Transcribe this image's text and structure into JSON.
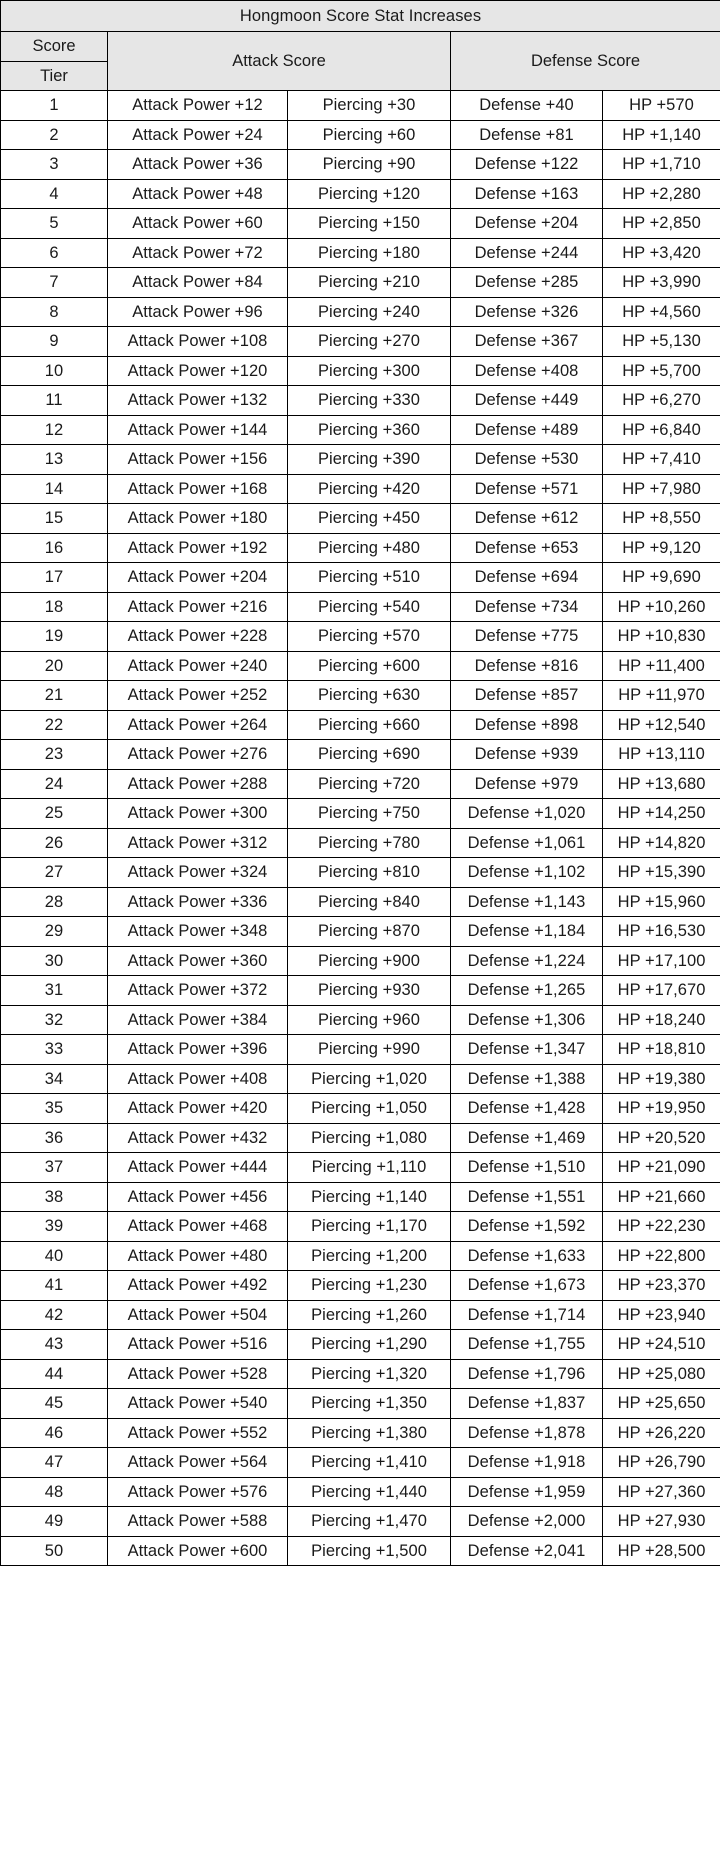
{
  "table": {
    "title": "Hongmoon Score Stat Increases",
    "header": {
      "score_label": "Score",
      "tier_label": "Tier",
      "attack_group": "Attack Score",
      "defense_group": "Defense Score"
    },
    "columns": [
      "Tier",
      "Attack Power",
      "Piercing",
      "Defense",
      "HP"
    ],
    "colors": {
      "header_bg": "#e6e6e6",
      "body_bg": "#ffffff",
      "border": "#000000",
      "text": "#1a1a1a"
    },
    "rows": [
      {
        "tier": "1",
        "attack": "Attack Power +12",
        "piercing": "Piercing +30",
        "defense": "Defense +40",
        "hp": "HP +570"
      },
      {
        "tier": "2",
        "attack": "Attack Power +24",
        "piercing": "Piercing +60",
        "defense": "Defense +81",
        "hp": "HP +1,140"
      },
      {
        "tier": "3",
        "attack": "Attack Power +36",
        "piercing": "Piercing +90",
        "defense": "Defense +122",
        "hp": "HP +1,710"
      },
      {
        "tier": "4",
        "attack": "Attack Power +48",
        "piercing": "Piercing +120",
        "defense": "Defense +163",
        "hp": "HP +2,280"
      },
      {
        "tier": "5",
        "attack": "Attack Power +60",
        "piercing": "Piercing +150",
        "defense": "Defense +204",
        "hp": "HP +2,850"
      },
      {
        "tier": "6",
        "attack": "Attack Power +72",
        "piercing": "Piercing +180",
        "defense": "Defense +244",
        "hp": "HP +3,420"
      },
      {
        "tier": "7",
        "attack": "Attack Power +84",
        "piercing": "Piercing +210",
        "defense": "Defense +285",
        "hp": "HP +3,990"
      },
      {
        "tier": "8",
        "attack": "Attack Power +96",
        "piercing": "Piercing +240",
        "defense": "Defense +326",
        "hp": "HP +4,560"
      },
      {
        "tier": "9",
        "attack": "Attack Power +108",
        "piercing": "Piercing +270",
        "defense": "Defense +367",
        "hp": "HP +5,130"
      },
      {
        "tier": "10",
        "attack": "Attack Power +120",
        "piercing": "Piercing +300",
        "defense": "Defense +408",
        "hp": "HP +5,700"
      },
      {
        "tier": "11",
        "attack": "Attack Power +132",
        "piercing": "Piercing +330",
        "defense": "Defense +449",
        "hp": "HP +6,270"
      },
      {
        "tier": "12",
        "attack": "Attack Power +144",
        "piercing": "Piercing +360",
        "defense": "Defense +489",
        "hp": "HP +6,840"
      },
      {
        "tier": "13",
        "attack": "Attack Power +156",
        "piercing": "Piercing +390",
        "defense": "Defense +530",
        "hp": "HP +7,410"
      },
      {
        "tier": "14",
        "attack": "Attack Power +168",
        "piercing": "Piercing +420",
        "defense": "Defense +571",
        "hp": "HP +7,980"
      },
      {
        "tier": "15",
        "attack": "Attack Power +180",
        "piercing": "Piercing +450",
        "defense": "Defense +612",
        "hp": "HP +8,550"
      },
      {
        "tier": "16",
        "attack": "Attack Power +192",
        "piercing": "Piercing +480",
        "defense": "Defense +653",
        "hp": "HP +9,120"
      },
      {
        "tier": "17",
        "attack": "Attack Power +204",
        "piercing": "Piercing +510",
        "defense": "Defense +694",
        "hp": "HP +9,690"
      },
      {
        "tier": "18",
        "attack": "Attack Power +216",
        "piercing": "Piercing +540",
        "defense": "Defense +734",
        "hp": "HP +10,260"
      },
      {
        "tier": "19",
        "attack": "Attack Power +228",
        "piercing": "Piercing +570",
        "defense": "Defense +775",
        "hp": "HP +10,830"
      },
      {
        "tier": "20",
        "attack": "Attack Power +240",
        "piercing": "Piercing +600",
        "defense": "Defense +816",
        "hp": "HP +11,400"
      },
      {
        "tier": "21",
        "attack": "Attack Power +252",
        "piercing": "Piercing +630",
        "defense": "Defense +857",
        "hp": "HP +11,970"
      },
      {
        "tier": "22",
        "attack": "Attack Power +264",
        "piercing": "Piercing +660",
        "defense": "Defense +898",
        "hp": "HP +12,540"
      },
      {
        "tier": "23",
        "attack": "Attack Power +276",
        "piercing": "Piercing +690",
        "defense": "Defense +939",
        "hp": "HP +13,110"
      },
      {
        "tier": "24",
        "attack": "Attack Power +288",
        "piercing": "Piercing +720",
        "defense": "Defense +979",
        "hp": "HP +13,680"
      },
      {
        "tier": "25",
        "attack": "Attack Power +300",
        "piercing": "Piercing +750",
        "defense": "Defense +1,020",
        "hp": "HP +14,250"
      },
      {
        "tier": "26",
        "attack": "Attack Power +312",
        "piercing": "Piercing +780",
        "defense": "Defense +1,061",
        "hp": "HP +14,820"
      },
      {
        "tier": "27",
        "attack": "Attack Power +324",
        "piercing": "Piercing +810",
        "defense": "Defense +1,102",
        "hp": "HP +15,390"
      },
      {
        "tier": "28",
        "attack": "Attack Power +336",
        "piercing": "Piercing +840",
        "defense": "Defense +1,143",
        "hp": "HP +15,960"
      },
      {
        "tier": "29",
        "attack": "Attack Power +348",
        "piercing": "Piercing +870",
        "defense": "Defense +1,184",
        "hp": "HP +16,530"
      },
      {
        "tier": "30",
        "attack": "Attack Power +360",
        "piercing": "Piercing +900",
        "defense": "Defense +1,224",
        "hp": "HP +17,100"
      },
      {
        "tier": "31",
        "attack": "Attack Power +372",
        "piercing": "Piercing +930",
        "defense": "Defense +1,265",
        "hp": "HP +17,670"
      },
      {
        "tier": "32",
        "attack": "Attack Power +384",
        "piercing": "Piercing +960",
        "defense": "Defense +1,306",
        "hp": "HP +18,240"
      },
      {
        "tier": "33",
        "attack": "Attack Power +396",
        "piercing": "Piercing +990",
        "defense": "Defense +1,347",
        "hp": "HP +18,810"
      },
      {
        "tier": "34",
        "attack": "Attack Power +408",
        "piercing": "Piercing +1,020",
        "defense": "Defense +1,388",
        "hp": "HP +19,380"
      },
      {
        "tier": "35",
        "attack": "Attack Power +420",
        "piercing": "Piercing +1,050",
        "defense": "Defense +1,428",
        "hp": "HP +19,950"
      },
      {
        "tier": "36",
        "attack": "Attack Power +432",
        "piercing": "Piercing +1,080",
        "defense": "Defense +1,469",
        "hp": "HP +20,520"
      },
      {
        "tier": "37",
        "attack": "Attack Power +444",
        "piercing": "Piercing +1,110",
        "defense": "Defense +1,510",
        "hp": "HP +21,090"
      },
      {
        "tier": "38",
        "attack": "Attack Power +456",
        "piercing": "Piercing +1,140",
        "defense": "Defense +1,551",
        "hp": "HP +21,660"
      },
      {
        "tier": "39",
        "attack": "Attack Power +468",
        "piercing": "Piercing +1,170",
        "defense": "Defense +1,592",
        "hp": "HP +22,230"
      },
      {
        "tier": "40",
        "attack": "Attack Power +480",
        "piercing": "Piercing +1,200",
        "defense": "Defense +1,633",
        "hp": "HP +22,800"
      },
      {
        "tier": "41",
        "attack": "Attack Power +492",
        "piercing": "Piercing +1,230",
        "defense": "Defense +1,673",
        "hp": "HP +23,370"
      },
      {
        "tier": "42",
        "attack": "Attack Power +504",
        "piercing": "Piercing +1,260",
        "defense": "Defense +1,714",
        "hp": "HP +23,940"
      },
      {
        "tier": "43",
        "attack": "Attack Power +516",
        "piercing": "Piercing +1,290",
        "defense": "Defense +1,755",
        "hp": "HP +24,510"
      },
      {
        "tier": "44",
        "attack": "Attack Power +528",
        "piercing": "Piercing +1,320",
        "defense": "Defense +1,796",
        "hp": "HP +25,080"
      },
      {
        "tier": "45",
        "attack": "Attack Power +540",
        "piercing": "Piercing +1,350",
        "defense": "Defense +1,837",
        "hp": "HP +25,650"
      },
      {
        "tier": "46",
        "attack": "Attack Power +552",
        "piercing": "Piercing +1,380",
        "defense": "Defense +1,878",
        "hp": "HP +26,220"
      },
      {
        "tier": "47",
        "attack": "Attack Power +564",
        "piercing": "Piercing +1,410",
        "defense": "Defense +1,918",
        "hp": "HP +26,790"
      },
      {
        "tier": "48",
        "attack": "Attack Power +576",
        "piercing": "Piercing +1,440",
        "defense": "Defense +1,959",
        "hp": "HP +27,360"
      },
      {
        "tier": "49",
        "attack": "Attack Power +588",
        "piercing": "Piercing +1,470",
        "defense": "Defense +2,000",
        "hp": "HP +27,930"
      },
      {
        "tier": "50",
        "attack": "Attack Power +600",
        "piercing": "Piercing +1,500",
        "defense": "Defense +2,041",
        "hp": "HP +28,500"
      }
    ]
  }
}
